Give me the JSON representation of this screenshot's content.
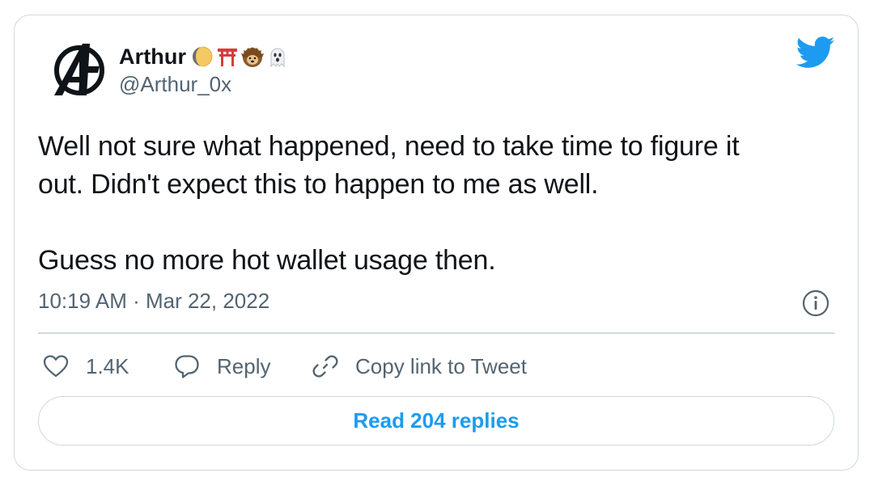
{
  "author": {
    "display_name": "Arthur",
    "handle": "@Arthur_0x",
    "name_emojis": [
      "moon-emoji",
      "torii-gate-emoji",
      "hedgehog-emoji",
      "ghost-emoji"
    ]
  },
  "tweet": {
    "lines": [
      "Well not sure what happened, need to take time to figure it",
      "out. Didn't expect this to happen to me as well.",
      "Guess no more hot wallet usage then."
    ],
    "timestamp": "10:19 AM · Mar 22, 2022"
  },
  "actions": {
    "like_count": "1.4K",
    "reply_label": "Reply",
    "copy_label": "Copy link to Tweet"
  },
  "read_replies_label": "Read 204 replies",
  "colors": {
    "brand_blue": "#1d9bf0",
    "text_primary": "#0f1419",
    "text_secondary": "#536471",
    "border": "#cfd9de"
  }
}
